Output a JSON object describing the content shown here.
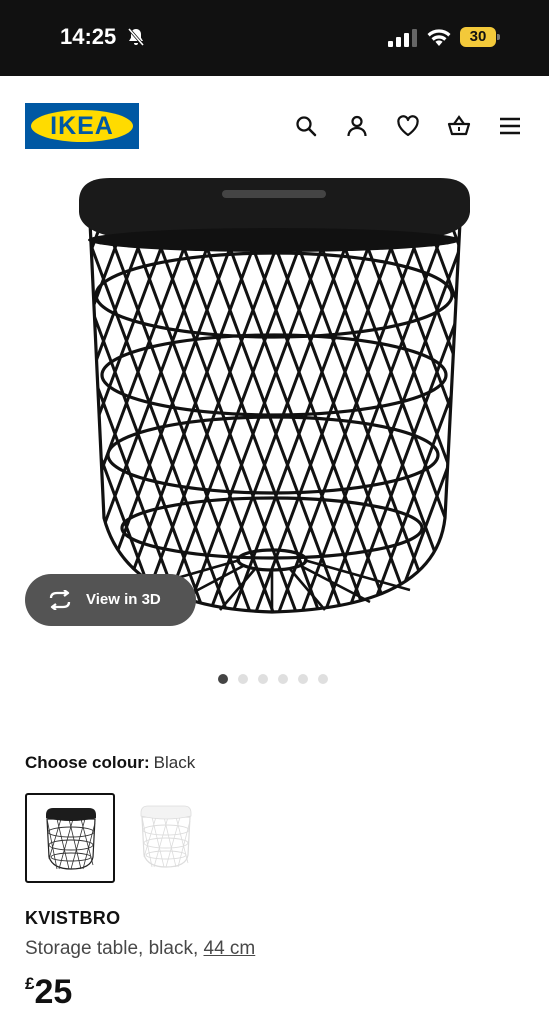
{
  "status_bar": {
    "time": "14:25",
    "battery": "30"
  },
  "header": {
    "logo_text": "IKEA",
    "icons": [
      "search-icon",
      "user-icon",
      "heart-icon",
      "basket-icon",
      "menu-icon"
    ]
  },
  "gallery": {
    "view_3d_label": "View in 3D",
    "image_count": 6,
    "active_image": 1
  },
  "colour": {
    "label": "Choose colour:",
    "value": "Black",
    "options": [
      "Black",
      "White"
    ]
  },
  "product": {
    "name": "KVISTBRO",
    "description_prefix": "Storage table, black, ",
    "size": "44 cm",
    "price_currency": "£",
    "price_amount": "25"
  },
  "colors": {
    "status_bar_bg": "#111111",
    "ikea_blue": "#0058a3",
    "ikea_yellow": "#ffdb00",
    "battery": "#f3c93a"
  }
}
